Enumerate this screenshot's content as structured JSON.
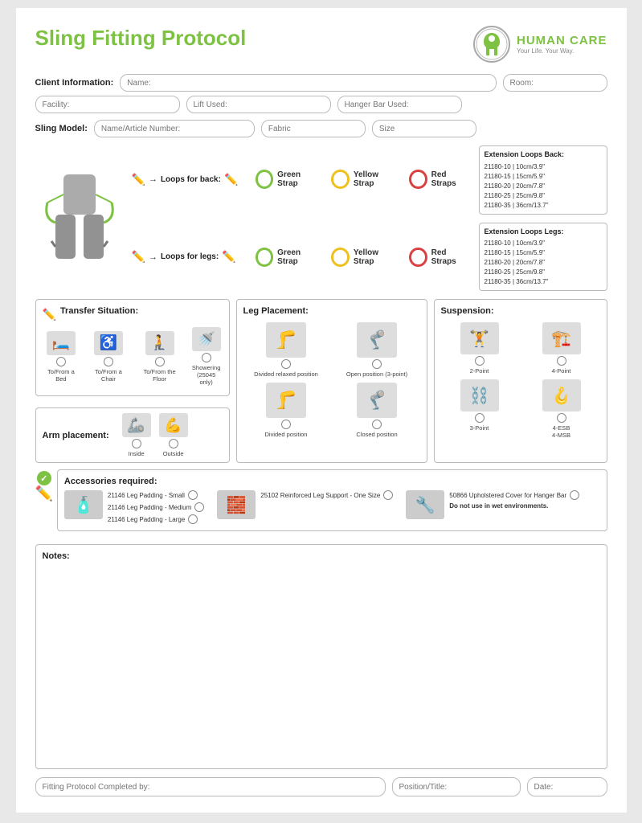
{
  "title": "Sling Fitting Protocol",
  "logo": {
    "brand": "HUMAN CARE",
    "brand_human": "HUMAN",
    "brand_care": "CARE",
    "tagline": "Your Life. Your Way."
  },
  "client_info": {
    "label": "Client Information:",
    "name_placeholder": "Name:",
    "room_placeholder": "Room:",
    "facility_placeholder": "Facility:",
    "lift_placeholder": "Lift Used:",
    "hanger_placeholder": "Hanger Bar Used:"
  },
  "sling_model": {
    "label": "Sling Model:",
    "article_placeholder": "Name/Article Number:",
    "fabric_placeholder": "Fabric",
    "size_placeholder": "Size"
  },
  "straps": {
    "back": {
      "label": "Loops for back:",
      "options": [
        "Green Strap",
        "Yellow Strap",
        "Red Straps"
      ]
    },
    "legs": {
      "label": "Loops for legs:",
      "options": [
        "Green Strap",
        "Yellow Strap",
        "Red Straps"
      ]
    }
  },
  "extension_loops_back": {
    "title": "Extension Loops Back:",
    "items": [
      "21180-10 | 10cm/3.9\"",
      "21180-15 | 15cm/5.9\"",
      "21180-20 | 20cm/7.8\"",
      "21180-25 | 25cm/9.8\"",
      "21180-35 | 36cm/13.7\""
    ]
  },
  "extension_loops_legs": {
    "title": "Extension Loops Legs:",
    "items": [
      "21180-10 | 10cm/3.9\"",
      "21180-15 | 15cm/5.9\"",
      "21180-20 | 20cm/7.8\"",
      "21180-25 | 25cm/9.8\"",
      "21180-35 | 36cm/13.7\""
    ]
  },
  "transfer": {
    "title": "Transfer Situation:",
    "options": [
      {
        "label": "To/From a Bed",
        "icon": "🛏️"
      },
      {
        "label": "To/From a Chair",
        "icon": "♿"
      },
      {
        "label": "To/From the Floor",
        "icon": "🧎"
      },
      {
        "label": "Showering\n(25045 only)",
        "icon": "🚿"
      }
    ]
  },
  "arm_placement": {
    "title": "Arm placement:",
    "options": [
      {
        "label": "Inside",
        "icon": "🦾"
      },
      {
        "label": "Outside",
        "icon": "💪"
      }
    ]
  },
  "leg_placement": {
    "title": "Leg Placement:",
    "options": [
      {
        "label": "Divided relaxed position",
        "icon": "🦵"
      },
      {
        "label": "Open position (3-point)",
        "icon": "🦿"
      },
      {
        "label": "Divided position",
        "icon": "🦵"
      },
      {
        "label": "Closed position",
        "icon": "🦿"
      }
    ]
  },
  "suspension": {
    "title": "Suspension:",
    "options": [
      {
        "label": "2-Point",
        "icon": "🏋️"
      },
      {
        "label": "4-Point",
        "icon": "🏗️"
      },
      {
        "label": "3-Point",
        "icon": "⛓️"
      },
      {
        "label": "4-ESB\n4-MSB",
        "icon": "🪝"
      }
    ]
  },
  "accessories": {
    "title": "Accessories required:",
    "groups": [
      {
        "items": [
          {
            "label": "21146 Leg Padding - Small",
            "checked": false
          },
          {
            "label": "21146 Leg Padding - Medium",
            "checked": false
          },
          {
            "label": "21146 Leg Padding - Large",
            "checked": false
          }
        ]
      },
      {
        "items": [
          {
            "label": "25102 Reinforced Leg Support - One Size",
            "checked": false
          }
        ]
      },
      {
        "items": [
          {
            "label": "50866 Upholstered Cover for Hanger Bar",
            "checked": false
          },
          {
            "label": "Do not use in wet environments.",
            "checked": null
          }
        ]
      }
    ]
  },
  "notes": {
    "label": "Notes:"
  },
  "footer": {
    "completed_placeholder": "Fitting Protocol Completed by:",
    "position_placeholder": "Position/Title:",
    "date_placeholder": "Date:"
  }
}
